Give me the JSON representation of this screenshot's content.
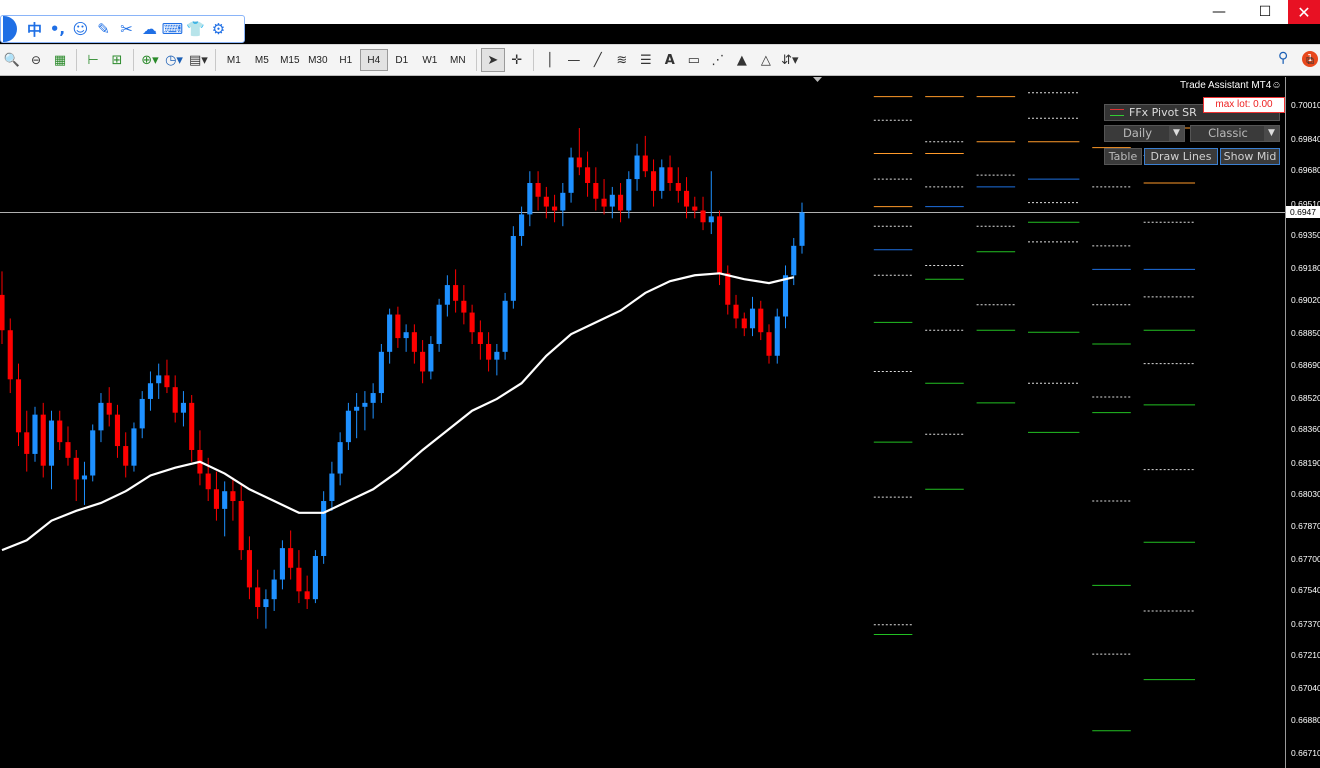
{
  "window": {
    "minimize": "—",
    "maximize": "☐",
    "close": "✕"
  },
  "ime_toolbar": {
    "items": [
      {
        "name": "ime-chinese-mode",
        "glyph": "中"
      },
      {
        "name": "ime-punctuation",
        "glyph": "•,"
      },
      {
        "name": "ime-emoji",
        "glyph": "☺"
      },
      {
        "name": "ime-handwrite",
        "glyph": "✎"
      },
      {
        "name": "ime-tools",
        "glyph": "✂"
      },
      {
        "name": "ime-cloud",
        "glyph": "☁"
      },
      {
        "name": "ime-keyboard",
        "glyph": "⌨"
      },
      {
        "name": "ime-skin",
        "glyph": "👕"
      },
      {
        "name": "ime-settings",
        "glyph": "⚙"
      }
    ]
  },
  "toolbar": {
    "timeframes": [
      "M1",
      "M5",
      "M15",
      "M30",
      "H1",
      "H4",
      "D1",
      "W1",
      "MN"
    ],
    "active_timeframe": "H4",
    "notification_count": "1"
  },
  "chart": {
    "trade_assistant": "Trade Assistant MT4☺",
    "max_lot": "max lot: 0.00",
    "panel_title": "FFx Pivot SR",
    "period_select": "Daily",
    "type_select": "Classic",
    "buttons": [
      "Table",
      "Draw Lines",
      "Show Mid"
    ],
    "current_price": "0.6947",
    "colors": {
      "up": "#1e90ff",
      "down": "#ff0000",
      "ma": "#ffffff",
      "resistance": "#ff9a2a",
      "support": "#22c022",
      "pivot": "#1e6fe0",
      "mid": "#dddddd",
      "background": "#000000"
    }
  },
  "chart_data": {
    "type": "candlestick",
    "price_axis_ticks": [
      "0.70010",
      "0.69840",
      "0.69680",
      "0.69510",
      "0.69350",
      "0.69180",
      "0.69020",
      "0.68850",
      "0.68690",
      "0.68520",
      "0.68360",
      "0.68190",
      "0.68030",
      "0.67870",
      "0.67700",
      "0.67540",
      "0.67370",
      "0.67210",
      "0.67040",
      "0.66880",
      "0.66710"
    ],
    "ylim": [
      0.6664,
      0.7016
    ],
    "candles": [
      [
        0.6905,
        0.6917,
        0.688,
        0.6887
      ],
      [
        0.6887,
        0.6893,
        0.6855,
        0.6862
      ],
      [
        0.6862,
        0.687,
        0.6828,
        0.6835
      ],
      [
        0.6835,
        0.6846,
        0.6815,
        0.6824
      ],
      [
        0.6824,
        0.6848,
        0.682,
        0.6844
      ],
      [
        0.6844,
        0.685,
        0.6812,
        0.6818
      ],
      [
        0.6818,
        0.6846,
        0.6806,
        0.6841
      ],
      [
        0.6841,
        0.6846,
        0.6826,
        0.683
      ],
      [
        0.683,
        0.6838,
        0.6818,
        0.6822
      ],
      [
        0.6822,
        0.6826,
        0.68,
        0.6811
      ],
      [
        0.6811,
        0.682,
        0.6798,
        0.6813
      ],
      [
        0.6813,
        0.6839,
        0.681,
        0.6836
      ],
      [
        0.6836,
        0.6855,
        0.683,
        0.685
      ],
      [
        0.685,
        0.6858,
        0.6838,
        0.6844
      ],
      [
        0.6844,
        0.6849,
        0.6822,
        0.6828
      ],
      [
        0.6828,
        0.6835,
        0.6812,
        0.6818
      ],
      [
        0.6818,
        0.684,
        0.6815,
        0.6837
      ],
      [
        0.6837,
        0.6856,
        0.6832,
        0.6852
      ],
      [
        0.6852,
        0.6866,
        0.6846,
        0.686
      ],
      [
        0.686,
        0.687,
        0.6852,
        0.6864
      ],
      [
        0.6864,
        0.6872,
        0.6855,
        0.6858
      ],
      [
        0.6858,
        0.6864,
        0.684,
        0.6845
      ],
      [
        0.6845,
        0.6856,
        0.6838,
        0.685
      ],
      [
        0.685,
        0.6854,
        0.682,
        0.6826
      ],
      [
        0.6826,
        0.6836,
        0.6808,
        0.6814
      ],
      [
        0.6814,
        0.6822,
        0.68,
        0.6806
      ],
      [
        0.6806,
        0.6815,
        0.679,
        0.6796
      ],
      [
        0.6796,
        0.681,
        0.6782,
        0.6805
      ],
      [
        0.6805,
        0.6812,
        0.679,
        0.68
      ],
      [
        0.68,
        0.6808,
        0.677,
        0.6775
      ],
      [
        0.6775,
        0.6782,
        0.675,
        0.6756
      ],
      [
        0.6756,
        0.6765,
        0.674,
        0.6746
      ],
      [
        0.6746,
        0.6755,
        0.6735,
        0.675
      ],
      [
        0.675,
        0.6765,
        0.6744,
        0.676
      ],
      [
        0.676,
        0.678,
        0.6755,
        0.6776
      ],
      [
        0.6776,
        0.6785,
        0.676,
        0.6766
      ],
      [
        0.6766,
        0.6775,
        0.6748,
        0.6754
      ],
      [
        0.6754,
        0.6762,
        0.6745,
        0.675
      ],
      [
        0.675,
        0.6775,
        0.6748,
        0.6772
      ],
      [
        0.6772,
        0.6805,
        0.6768,
        0.68
      ],
      [
        0.68,
        0.682,
        0.6795,
        0.6814
      ],
      [
        0.6814,
        0.6835,
        0.6808,
        0.683
      ],
      [
        0.683,
        0.685,
        0.6826,
        0.6846
      ],
      [
        0.6846,
        0.6855,
        0.6832,
        0.6848
      ],
      [
        0.6848,
        0.6856,
        0.6836,
        0.685
      ],
      [
        0.685,
        0.686,
        0.6842,
        0.6855
      ],
      [
        0.6855,
        0.688,
        0.685,
        0.6876
      ],
      [
        0.6876,
        0.6898,
        0.687,
        0.6895
      ],
      [
        0.6895,
        0.6899,
        0.6878,
        0.6883
      ],
      [
        0.6883,
        0.689,
        0.6876,
        0.6886
      ],
      [
        0.6886,
        0.689,
        0.687,
        0.6876
      ],
      [
        0.6876,
        0.6882,
        0.686,
        0.6866
      ],
      [
        0.6866,
        0.6884,
        0.6862,
        0.688
      ],
      [
        0.688,
        0.6903,
        0.6876,
        0.69
      ],
      [
        0.69,
        0.6915,
        0.6894,
        0.691
      ],
      [
        0.691,
        0.6918,
        0.6896,
        0.6902
      ],
      [
        0.6902,
        0.691,
        0.689,
        0.6896
      ],
      [
        0.6896,
        0.69,
        0.688,
        0.6886
      ],
      [
        0.6886,
        0.6892,
        0.6872,
        0.688
      ],
      [
        0.688,
        0.6886,
        0.6866,
        0.6872
      ],
      [
        0.6872,
        0.688,
        0.6864,
        0.6876
      ],
      [
        0.6876,
        0.6906,
        0.6872,
        0.6902
      ],
      [
        0.6902,
        0.694,
        0.6898,
        0.6935
      ],
      [
        0.6935,
        0.695,
        0.693,
        0.6946
      ],
      [
        0.6946,
        0.6968,
        0.694,
        0.6962
      ],
      [
        0.6962,
        0.6968,
        0.6948,
        0.6955
      ],
      [
        0.6955,
        0.696,
        0.6944,
        0.695
      ],
      [
        0.695,
        0.6956,
        0.6942,
        0.6948
      ],
      [
        0.6948,
        0.6962,
        0.694,
        0.6957
      ],
      [
        0.6957,
        0.698,
        0.6952,
        0.6975
      ],
      [
        0.6975,
        0.699,
        0.6966,
        0.697
      ],
      [
        0.697,
        0.6978,
        0.6955,
        0.6962
      ],
      [
        0.6962,
        0.697,
        0.6948,
        0.6954
      ],
      [
        0.6954,
        0.6964,
        0.6946,
        0.695
      ],
      [
        0.695,
        0.696,
        0.6944,
        0.6956
      ],
      [
        0.6956,
        0.6962,
        0.6942,
        0.6948
      ],
      [
        0.6948,
        0.6968,
        0.6944,
        0.6964
      ],
      [
        0.6964,
        0.6982,
        0.6958,
        0.6976
      ],
      [
        0.6976,
        0.6986,
        0.6965,
        0.6968
      ],
      [
        0.6968,
        0.6974,
        0.695,
        0.6958
      ],
      [
        0.6958,
        0.6974,
        0.6954,
        0.697
      ],
      [
        0.697,
        0.6976,
        0.6958,
        0.6962
      ],
      [
        0.6962,
        0.697,
        0.6952,
        0.6958
      ],
      [
        0.6958,
        0.6965,
        0.6944,
        0.695
      ],
      [
        0.695,
        0.6955,
        0.6944,
        0.6948
      ],
      [
        0.6948,
        0.6955,
        0.6938,
        0.6942
      ],
      [
        0.6942,
        0.6968,
        0.6936,
        0.6945
      ],
      [
        0.6945,
        0.6948,
        0.691,
        0.6916
      ],
      [
        0.6916,
        0.692,
        0.6895,
        0.69
      ],
      [
        0.69,
        0.6905,
        0.6888,
        0.6893
      ],
      [
        0.6893,
        0.6896,
        0.6884,
        0.6888
      ],
      [
        0.6888,
        0.6904,
        0.6884,
        0.6898
      ],
      [
        0.6898,
        0.6902,
        0.6882,
        0.6886
      ],
      [
        0.6886,
        0.689,
        0.687,
        0.6874
      ],
      [
        0.6874,
        0.6898,
        0.687,
        0.6894
      ],
      [
        0.6894,
        0.692,
        0.6888,
        0.6915
      ],
      [
        0.6915,
        0.6934,
        0.691,
        0.693
      ],
      [
        0.693,
        0.6952,
        0.6926,
        0.6947
      ]
    ],
    "moving_average": [
      {
        "x": 0,
        "y": 0.6775
      },
      {
        "x": 6,
        "y": 0.678
      },
      {
        "x": 12,
        "y": 0.679
      },
      {
        "x": 18,
        "y": 0.6795
      },
      {
        "x": 24,
        "y": 0.6799
      },
      {
        "x": 30,
        "y": 0.6805
      },
      {
        "x": 36,
        "y": 0.6813
      },
      {
        "x": 42,
        "y": 0.6817
      },
      {
        "x": 48,
        "y": 0.682
      },
      {
        "x": 54,
        "y": 0.6814
      },
      {
        "x": 60,
        "y": 0.6806
      },
      {
        "x": 66,
        "y": 0.68
      },
      {
        "x": 72,
        "y": 0.6794
      },
      {
        "x": 78,
        "y": 0.6794
      },
      {
        "x": 84,
        "y": 0.68
      },
      {
        "x": 90,
        "y": 0.6806
      },
      {
        "x": 96,
        "y": 0.6815
      },
      {
        "x": 102,
        "y": 0.6826
      },
      {
        "x": 108,
        "y": 0.6836
      },
      {
        "x": 114,
        "y": 0.6846
      },
      {
        "x": 120,
        "y": 0.6852
      },
      {
        "x": 126,
        "y": 0.686
      },
      {
        "x": 132,
        "y": 0.6874
      },
      {
        "x": 138,
        "y": 0.6885
      },
      {
        "x": 144,
        "y": 0.6891
      },
      {
        "x": 150,
        "y": 0.6897
      },
      {
        "x": 156,
        "y": 0.6906
      },
      {
        "x": 162,
        "y": 0.6912
      },
      {
        "x": 168,
        "y": 0.6915
      },
      {
        "x": 174,
        "y": 0.6916
      },
      {
        "x": 180,
        "y": 0.6913
      },
      {
        "x": 186,
        "y": 0.6911
      },
      {
        "x": 192,
        "y": 0.6914
      }
    ],
    "pivot_columns": [
      {
        "from": 0.68,
        "to": 0.71,
        "R": [
          0.7006,
          0.6977,
          0.695
        ],
        "P": 0.6928,
        "M": [
          0.6994,
          0.6964,
          0.694,
          0.6915,
          0.6866,
          0.6802,
          0.6737
        ],
        "S": [
          0.6891,
          0.683,
          0.6732
        ]
      },
      {
        "from": 0.72,
        "to": 0.75,
        "R": [
          0.7006,
          0.6977
        ],
        "P": 0.695,
        "M": [
          0.6983,
          0.696,
          0.692,
          0.6887,
          0.6834
        ],
        "S": [
          0.6913,
          0.686,
          0.6806
        ]
      },
      {
        "from": 0.76,
        "to": 0.79,
        "R": [
          0.7006,
          0.6983
        ],
        "P": 0.696,
        "M": [
          0.6966,
          0.694,
          0.69
        ],
        "S": [
          0.6927,
          0.6887,
          0.685
        ]
      },
      {
        "from": 0.8,
        "to": 0.84,
        "R": [
          0.702,
          0.6983
        ],
        "P": 0.6964,
        "M": [
          0.7008,
          0.6995,
          0.6952,
          0.6932,
          0.686
        ],
        "S": [
          0.6942,
          0.6886,
          0.6835
        ]
      },
      {
        "from": 0.85,
        "to": 0.88,
        "R": [
          0.698
        ],
        "P": 0.6918,
        "M": [
          0.696,
          0.693,
          0.69,
          0.6853,
          0.68,
          0.6722
        ],
        "S": [
          0.688,
          0.6845,
          0.6757,
          0.6683
        ]
      },
      {
        "from": 0.89,
        "to": 0.93,
        "R": [
          0.699,
          0.6962
        ],
        "P": 0.6918,
        "M": [
          0.6976,
          0.6942,
          0.6904,
          0.687,
          0.6816,
          0.6744
        ],
        "S": [
          0.6887,
          0.6849,
          0.6779,
          0.6709
        ]
      }
    ]
  }
}
